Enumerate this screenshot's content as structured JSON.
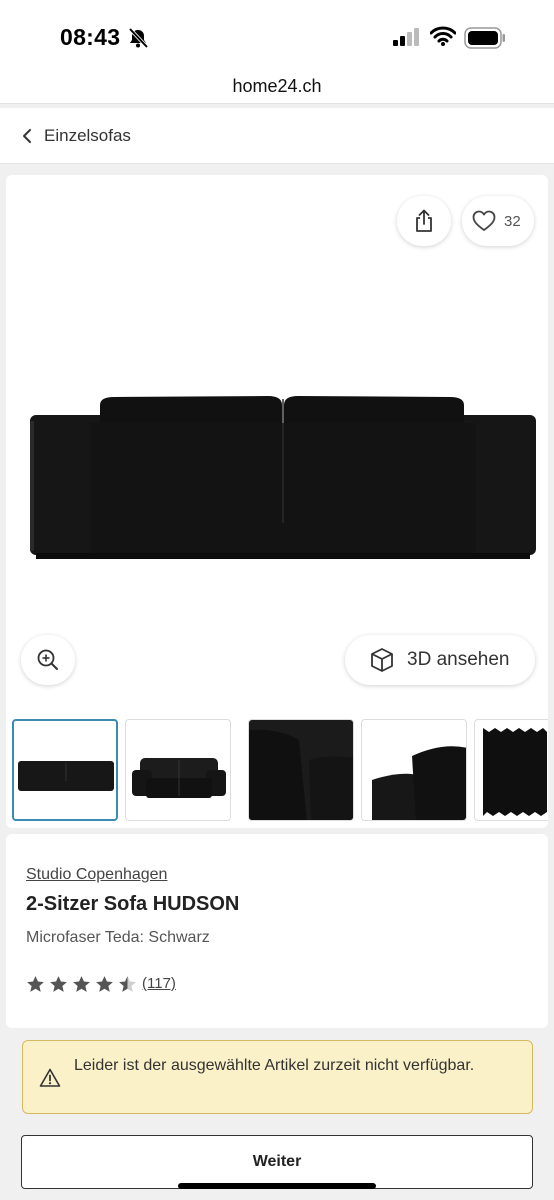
{
  "status": {
    "time": "08:43",
    "icons": [
      "bell-slash-icon",
      "cellular-signal-icon",
      "wifi-icon",
      "battery-icon"
    ]
  },
  "browser": {
    "url": "home24.ch"
  },
  "breadcrumb": {
    "label": "Einzelsofas",
    "icon": "chevron-left-icon"
  },
  "gallery": {
    "favorite_count": "32",
    "view3d_label": "3D ansehen",
    "icons": [
      "share-icon",
      "heart-icon",
      "zoom-in-icon",
      "cube-icon"
    ],
    "thumbnails": 5,
    "active_thumbnail": 1
  },
  "product": {
    "brand": "Studio Copenhagen",
    "title": "2-Sitzer Sofa HUDSON",
    "variant": "Microfaser Teda: Schwarz",
    "rating_stars": 4.5,
    "rating_max": 5,
    "review_count": "(117)"
  },
  "alert": {
    "text": "Leider ist der ausgewählte Artikel zurzeit nicht verfügbar."
  },
  "actions": {
    "next_label": "Weiter"
  },
  "colors": {
    "accent_thumb_border": "#3a8bb0",
    "alert_bg": "#faf1c8",
    "alert_border": "#d8b860",
    "sofa": "#141414"
  }
}
